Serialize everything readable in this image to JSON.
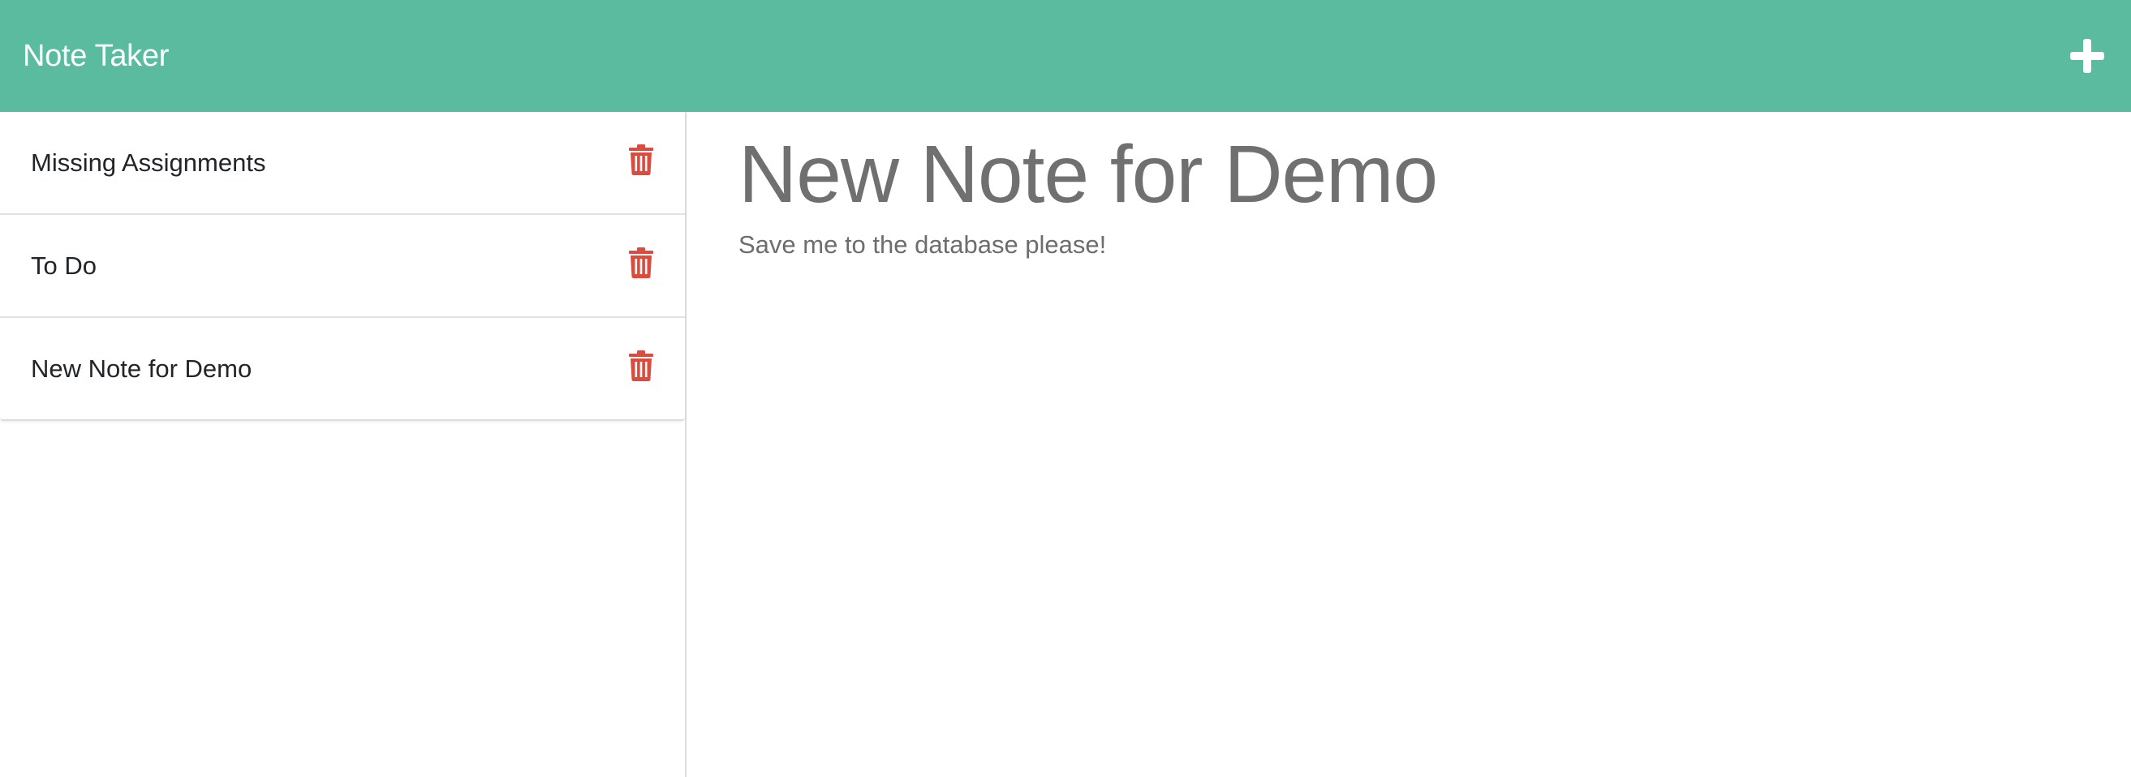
{
  "navbar": {
    "brand": "Note Taker",
    "new_note_icon": "plus-icon",
    "background_color": "#5bbb9f"
  },
  "sidebar": {
    "notes": [
      {
        "title": "Missing Assignments",
        "delete_icon": "trash-icon"
      },
      {
        "title": "To Do",
        "delete_icon": "trash-icon"
      },
      {
        "title": "New Note for Demo",
        "delete_icon": "trash-icon"
      }
    ],
    "delete_color": "#dc4c3e"
  },
  "active_note": {
    "title": "New Note for Demo",
    "text": "Save me to the database please!"
  }
}
